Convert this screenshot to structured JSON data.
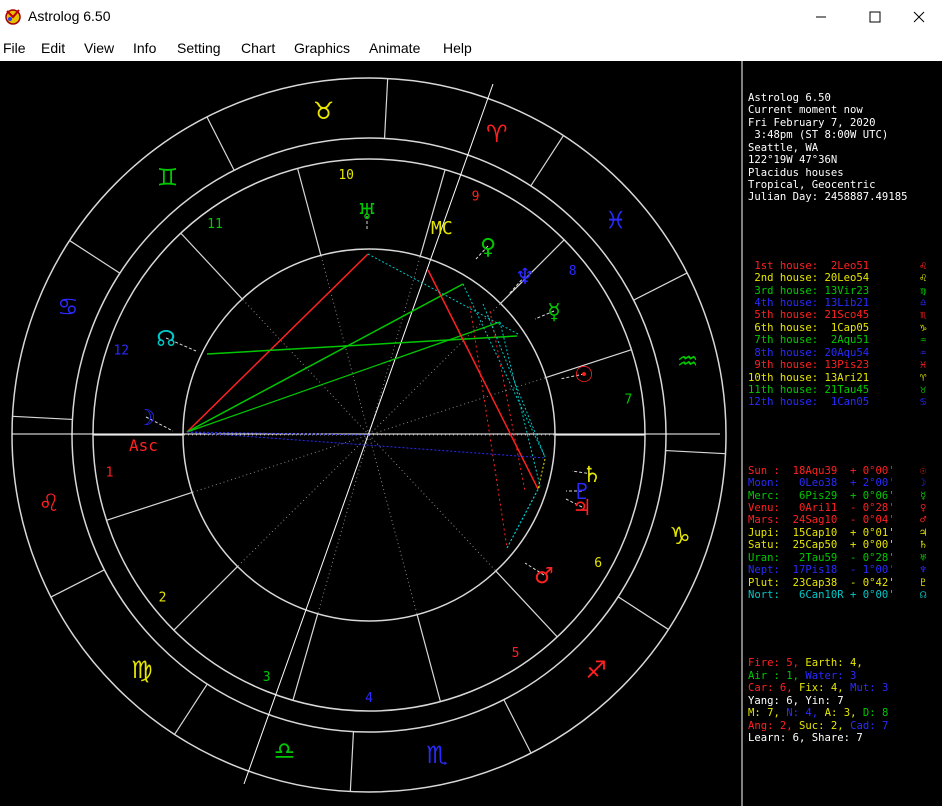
{
  "window": {
    "title": "Astrolog 6.50",
    "minimize_glyph": "—",
    "maximize_glyph": "☐",
    "close_glyph": "✕"
  },
  "menu": [
    "File",
    "Edit",
    "View",
    "Info",
    "Setting",
    "Chart",
    "Graphics",
    "Animate",
    "Help"
  ],
  "chart_header": [
    "Astrolog 6.50",
    "Current moment now",
    "Fri February 7, 2020",
    " 3:48pm (ST 8:00W UTC)",
    "Seattle, WA",
    "122°19W 47°36N",
    "Placidus houses",
    "Tropical, Geocentric",
    "Julian Day: 2458887.49185"
  ],
  "houses": [
    {
      "text": " 1st house:  2Leo51",
      "color": "#ff2020",
      "glyph": "♌"
    },
    {
      "text": " 2nd house: 20Leo54",
      "color": "#e6e600",
      "glyph": "♌"
    },
    {
      "text": " 3rd house: 13Vir23",
      "color": "#00c800",
      "glyph": "♍"
    },
    {
      "text": " 4th house: 13Lib21",
      "color": "#2a2aff",
      "glyph": "♎"
    },
    {
      "text": " 5th house: 21Sco45",
      "color": "#ff2020",
      "glyph": "♏"
    },
    {
      "text": " 6th house:  1Cap05",
      "color": "#e6e600",
      "glyph": "♑"
    },
    {
      "text": " 7th house:  2Aqu51",
      "color": "#00c800",
      "glyph": "♒"
    },
    {
      "text": " 8th house: 20Aqu54",
      "color": "#2a2aff",
      "glyph": "♒"
    },
    {
      "text": " 9th house: 13Pis23",
      "color": "#ff2020",
      "glyph": "♓"
    },
    {
      "text": "10th house: 13Ari21",
      "color": "#e6e600",
      "glyph": "♈"
    },
    {
      "text": "11th house: 21Tau45",
      "color": "#00c800",
      "glyph": "♉"
    },
    {
      "text": "12th house:  1Can05",
      "color": "#2a2aff",
      "glyph": "♋"
    }
  ],
  "planets": [
    {
      "text": "Sun :  18Aqu39  + 0°00'",
      "color": "#ff2020",
      "glyph": "☉"
    },
    {
      "text": "Moon:   0Leo38  + 2°00'",
      "color": "#2a2aff",
      "glyph": "☽"
    },
    {
      "text": "Merc:   6Pis29  + 0°06'",
      "color": "#00c800",
      "glyph": "☿"
    },
    {
      "text": "Venu:   0Ari11  - 0°28'",
      "color": "#ff2020",
      "glyph": "♀"
    },
    {
      "text": "Mars:  24Sag10  - 0°04'",
      "color": "#ff2020",
      "glyph": "♂"
    },
    {
      "text": "Jupi:  15Cap10  + 0°01'",
      "color": "#e6e600",
      "glyph": "♃"
    },
    {
      "text": "Satu:  25Cap50  + 0°00'",
      "color": "#e6e600",
      "glyph": "♄"
    },
    {
      "text": "Uran:   2Tau59  - 0°28'",
      "color": "#00c800",
      "glyph": "♅"
    },
    {
      "text": "Nept:  17Pis18  - 1°00'",
      "color": "#2a2aff",
      "glyph": "♆"
    },
    {
      "text": "Plut:  23Cap38  - 0°42'",
      "color": "#e6e600",
      "glyph": "♇"
    },
    {
      "text": "Nort:   6Can10R + 0°00'",
      "color": "#00c8c8",
      "glyph": "☊"
    }
  ],
  "elements": [
    [
      {
        "t": "Fire: 5, ",
        "c": "#ff2020"
      },
      {
        "t": "Earth: 4,",
        "c": "#e6e600"
      }
    ],
    [
      {
        "t": "Air : 1, ",
        "c": "#00c800"
      },
      {
        "t": "Water: 3",
        "c": "#2a2aff"
      }
    ],
    [
      {
        "t": "Car: 6, ",
        "c": "#ff2020"
      },
      {
        "t": "Fix: 4, ",
        "c": "#e6e600"
      },
      {
        "t": "Mut: 3",
        "c": "#2a2aff"
      }
    ],
    [
      {
        "t": "Yang: 6, Yin: 7",
        "c": "#ffffff"
      }
    ],
    [
      {
        "t": "M: 7, ",
        "c": "#e6e600"
      },
      {
        "t": "N: 4, ",
        "c": "#2a2aff"
      },
      {
        "t": "A: 3, ",
        "c": "#e6e600"
      },
      {
        "t": "D: 8",
        "c": "#00c800"
      }
    ],
    [
      {
        "t": "Ang: 2, ",
        "c": "#ff2020"
      },
      {
        "t": "Suc: 2, ",
        "c": "#e6e600"
      },
      {
        "t": "Cad: 7",
        "c": "#2a2aff"
      }
    ],
    [
      {
        "t": "Learn: 6, Share: 7",
        "c": "#ffffff"
      }
    ]
  ],
  "wheel": {
    "asc_label": "Asc",
    "mc_label": "MC",
    "house_numbers": [
      {
        "n": "1",
        "color": "#ff2020"
      },
      {
        "n": "2",
        "color": "#e6e600"
      },
      {
        "n": "3",
        "color": "#00c800"
      },
      {
        "n": "4",
        "color": "#2a2aff"
      },
      {
        "n": "5",
        "color": "#ff2020"
      },
      {
        "n": "6",
        "color": "#e6e600"
      },
      {
        "n": "7",
        "color": "#00c800"
      },
      {
        "n": "8",
        "color": "#2a2aff"
      },
      {
        "n": "9",
        "color": "#ff2020"
      },
      {
        "n": "10",
        "color": "#e6e600"
      },
      {
        "n": "11",
        "color": "#00c800"
      },
      {
        "n": "12",
        "color": "#2a2aff"
      }
    ],
    "signs": [
      {
        "glyph": "♈",
        "color": "#ff2020"
      },
      {
        "glyph": "♉",
        "color": "#e6e600"
      },
      {
        "glyph": "♊",
        "color": "#00c800"
      },
      {
        "glyph": "♋",
        "color": "#2a2aff"
      },
      {
        "glyph": "♌",
        "color": "#ff2020"
      },
      {
        "glyph": "♍",
        "color": "#e6e600"
      },
      {
        "glyph": "♎",
        "color": "#00c800"
      },
      {
        "glyph": "♏",
        "color": "#2a2aff"
      },
      {
        "glyph": "♐",
        "color": "#ff2020"
      },
      {
        "glyph": "♑",
        "color": "#e6e600"
      },
      {
        "glyph": "♒",
        "color": "#00c800"
      },
      {
        "glyph": "♓",
        "color": "#2a2aff"
      }
    ],
    "planet_glyphs": [
      {
        "glyph": "☉",
        "color": "#ff2020"
      },
      {
        "glyph": "☽",
        "color": "#2a2aff"
      },
      {
        "glyph": "☿",
        "color": "#00c800"
      },
      {
        "glyph": "♀",
        "color": "#00c800"
      },
      {
        "glyph": "♂",
        "color": "#ff2020"
      },
      {
        "glyph": "♃",
        "color": "#ff2020"
      },
      {
        "glyph": "♄",
        "color": "#e6e600"
      },
      {
        "glyph": "♅",
        "color": "#00c800"
      },
      {
        "glyph": "♆",
        "color": "#2a2aff"
      },
      {
        "glyph": "♇",
        "color": "#2a2aff"
      },
      {
        "glyph": "☊",
        "color": "#00c8c8"
      }
    ]
  }
}
